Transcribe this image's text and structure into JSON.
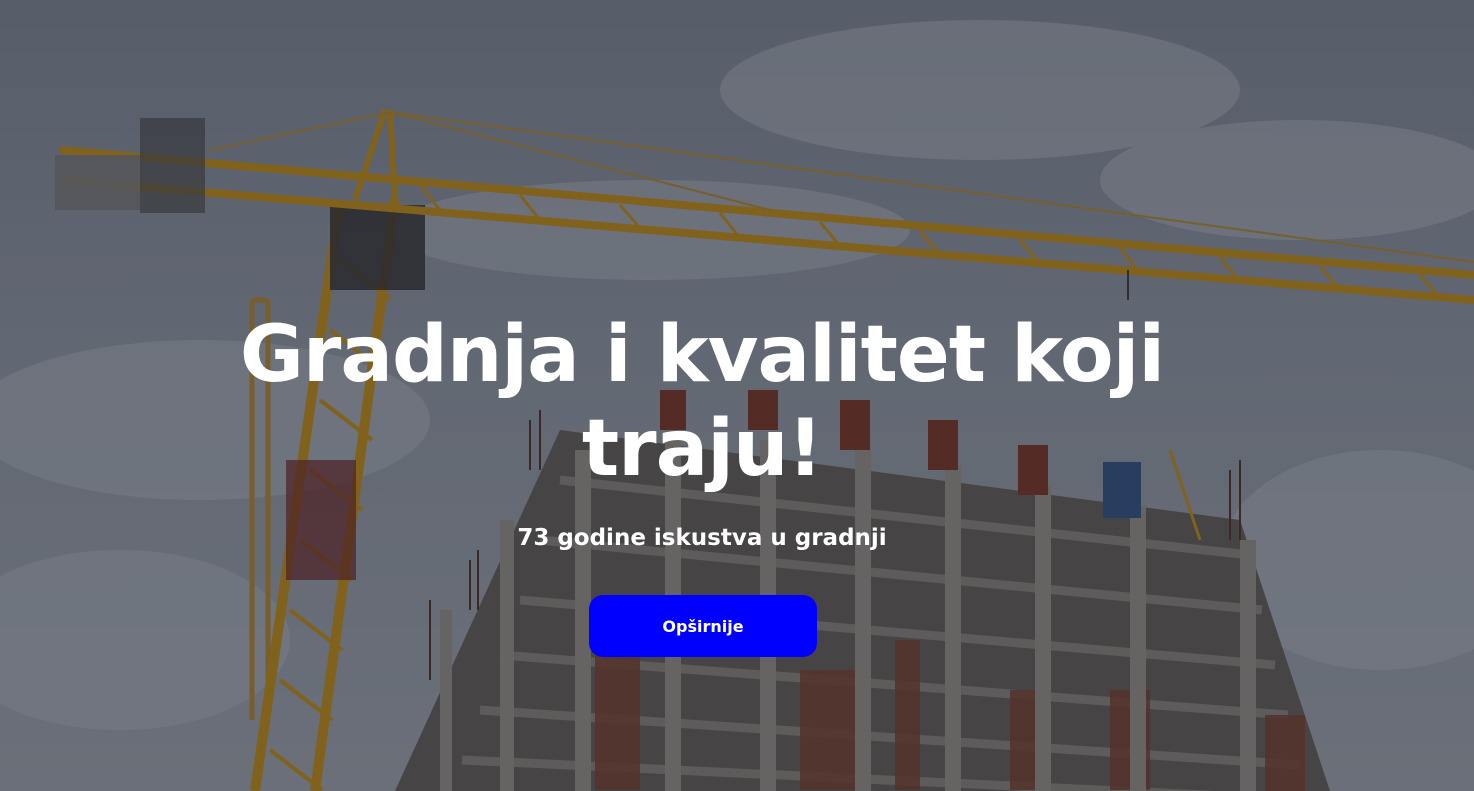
{
  "hero": {
    "title": "Gradnja i kvalitet koji traju!",
    "subtitle": "73 godine iskustva u gradnji",
    "button_label": "Opširnije"
  },
  "colors": {
    "button_bg": "#0000ff",
    "text": "#ffffff",
    "crane": "#d9a11c"
  }
}
